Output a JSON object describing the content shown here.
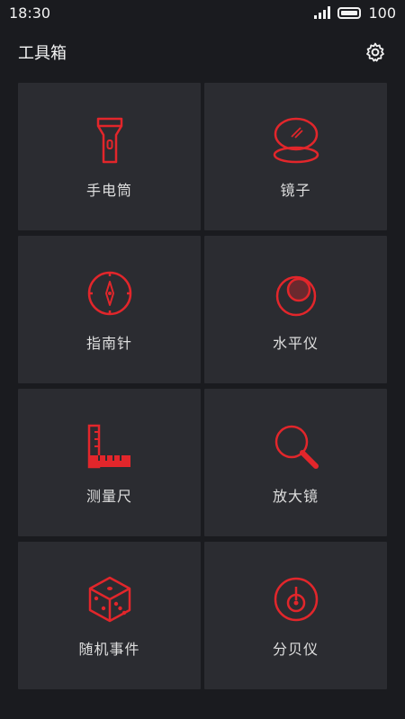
{
  "status": {
    "time": "18:30",
    "battery": "100"
  },
  "header": {
    "title": "工具箱",
    "settings_icon": "gear-icon"
  },
  "tiles": [
    {
      "label": "手电筒",
      "icon": "flashlight-icon"
    },
    {
      "label": "镜子",
      "icon": "mirror-icon"
    },
    {
      "label": "指南针",
      "icon": "compass-icon"
    },
    {
      "label": "水平仪",
      "icon": "level-icon"
    },
    {
      "label": "测量尺",
      "icon": "ruler-icon"
    },
    {
      "label": "放大镜",
      "icon": "magnifier-icon"
    },
    {
      "label": "随机事件",
      "icon": "dice-icon"
    },
    {
      "label": "分贝仪",
      "icon": "decibel-icon"
    }
  ],
  "colors": {
    "accent": "#e2262b",
    "tile": "#2b2c31",
    "background": "#1a1b1f"
  }
}
